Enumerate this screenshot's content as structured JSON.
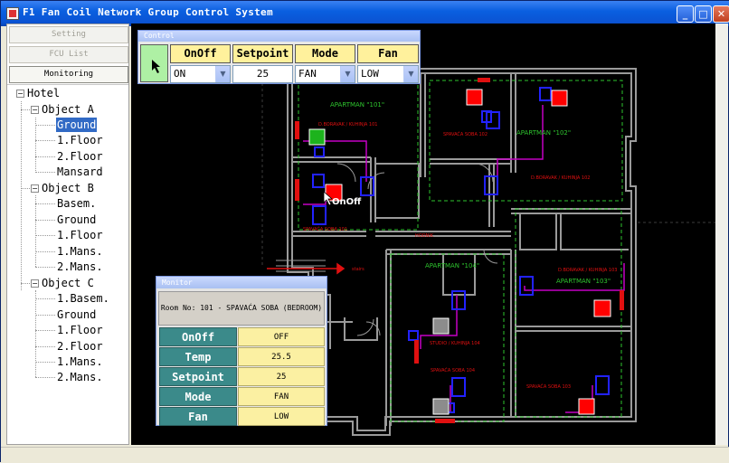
{
  "window": {
    "title": "F1 Fan Coil Network Group Control System"
  },
  "nav": {
    "setting": "Setting",
    "fcu_list": "FCU List",
    "monitoring": "Monitoring"
  },
  "tree": {
    "root": "Hotel",
    "object_a": "Object A",
    "a_ground": "Ground",
    "a_floor1": "1.Floor",
    "a_floor2": "2.Floor",
    "a_mansard": "Mansard",
    "object_b": "Object B",
    "b_basem": "Basem.",
    "b_ground": "Ground",
    "b_floor1": "1.Floor",
    "b_mans1": "1.Mans.",
    "b_mans2": "2.Mans.",
    "object_c": "Object C",
    "c_basem": "1.Basem.",
    "c_ground": "Ground",
    "c_floor1": "1.Floor",
    "c_floor2": "2.Floor",
    "c_mans1": "1.Mans.",
    "c_mans2": "2.Mans."
  },
  "control": {
    "title": "Control",
    "headers": {
      "onoff": "OnOff",
      "setpoint": "Setpoint",
      "mode": "Mode",
      "fan": "Fan"
    },
    "values": {
      "onoff": "ON",
      "setpoint": "25",
      "mode": "FAN",
      "fan": "LOW"
    }
  },
  "monitor": {
    "title": "Monitor",
    "room": "Room No: 101 - SPAVAĆA SOBA (BEDROOM)",
    "labels": {
      "onoff": "OnOff",
      "temp": "Temp",
      "setpoint": "Setpoint",
      "mode": "Mode",
      "fan": "Fan"
    },
    "values": {
      "onoff": "OFF",
      "temp": "25.5",
      "setpoint": "25",
      "mode": "FAN",
      "fan": "LOW"
    }
  },
  "plan": {
    "apt101": "APARTMAN \"101\"",
    "apt102": "APARTMAN \"102\"",
    "apt103": "APARTMAN \"103\"",
    "apt104": "APARTMAN \"104\"",
    "dnevni101": "D.BORAVAK / KUHINJA 101",
    "dnevni102": "D.BORAVAK / KUHINJA 102",
    "dnevni103": "D.BORAVAK / KUHINJA 103",
    "spavaca101": "SPAVAĆA SOBA 101",
    "spavaca102": "SPAVAĆA SOBA 102",
    "spavaca103": "SPAVAĆA SOBA 103",
    "spavaca104": "SPAVAĆA SOBA 104",
    "studio104": "STUDIO / KUHINJA 104",
    "hodnik": "HODNIK",
    "stairs": "stairs",
    "onoff_tag": "OnOff"
  },
  "colors": {
    "fcu_on": "#ff0000",
    "fcu_off": "#8c8c8c",
    "fcu_selected": "#1db31d",
    "walls": "#9a9a9a",
    "zone": "#2ec42e",
    "equipment": "#2222ff",
    "pipe": "#c400c4"
  }
}
